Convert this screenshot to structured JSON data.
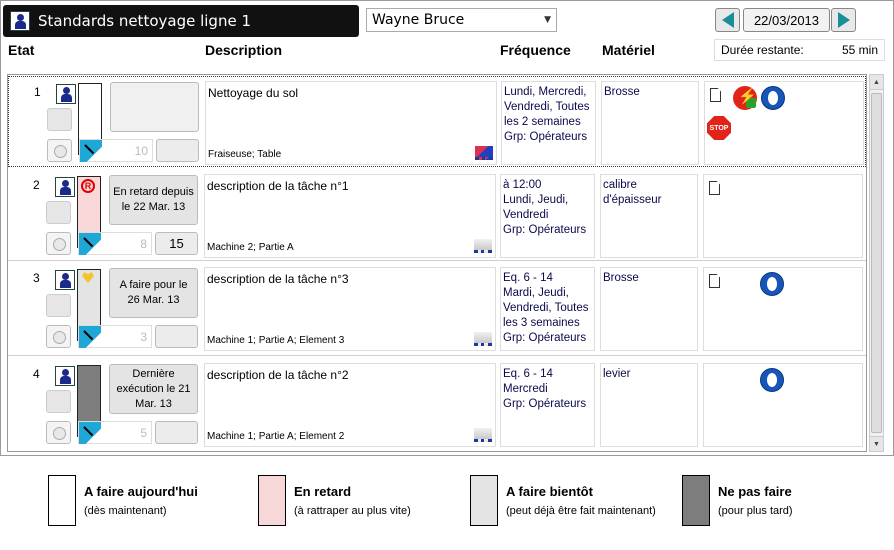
{
  "window": {
    "title": "Standards nettoyage ligne 1",
    "user": "Wayne Bruce",
    "date": "22/03/2013"
  },
  "columns": {
    "etat": "Etat",
    "description": "Description",
    "frequence": "Fréquence",
    "materiel": "Matériel"
  },
  "remaining": {
    "label": "Durée restante:",
    "value": "55 min"
  },
  "colors": {
    "today": "#ffffff",
    "late": "#f8d7d8",
    "soon": "#e4e4e4",
    "dont": "#7d7d7d",
    "accent": "#1a8f9a"
  },
  "rows": [
    {
      "num": "1",
      "status_color": "#ffffff",
      "status_label": "",
      "status_icon": "",
      "gauge_value": "10",
      "count": "",
      "description": "Nettoyage du sol",
      "location": "Fraiseuse; Table",
      "frequency": [
        "Lundi, Mercredi,",
        "Vendredi, Toutes",
        "les 2 semaines",
        "Grp: Opérateurs"
      ],
      "material": [
        "Brosse"
      ],
      "icons": [
        "document-icon",
        "electric-danger-icon",
        "safety-helmet-icon",
        "stop-sign-icon"
      ],
      "stop_label": "STOP"
    },
    {
      "num": "2",
      "status_color": "#f8d7d8",
      "status_label": "En retard depuis le 22 Mar. 13",
      "status_icon": "registered-icon",
      "gauge_value": "8",
      "count": "15",
      "description": "description de la tâche  n°1",
      "location": "Machine 2; Partie A",
      "frequency": [
        "à 12:00",
        "Lundi, Jeudi,",
        "Vendredi",
        "Grp: Opérateurs"
      ],
      "material": [
        "calibre",
        "d'épaisseur"
      ],
      "icons": [
        "document-icon"
      ]
    },
    {
      "num": "3",
      "status_color": "#e4e4e4",
      "status_label": "A faire pour le 26 Mar. 13",
      "status_icon": "heart-icon",
      "gauge_value": "3",
      "count": "",
      "description": "description de la tâche n°3",
      "location": "Machine 1; Partie A; Element 3",
      "frequency": [
        "Eq. 6 - 14",
        "Mardi, Jeudi,",
        "Vendredi, Toutes",
        "les 3 semaines",
        "Grp: Opérateurs"
      ],
      "material": [
        "Brosse"
      ],
      "icons": [
        "document-icon",
        "safety-helmet-icon"
      ]
    },
    {
      "num": "4",
      "status_color": "#7d7d7d",
      "status_label": "Dernière exécution le 21 Mar. 13",
      "status_icon": "",
      "gauge_value": "5",
      "count": "",
      "description": "description de la tâche n°2",
      "location": "Machine 1; Partie A; Element 2",
      "frequency": [
        "Eq. 6 - 14",
        "Mercredi",
        "Grp: Opérateurs"
      ],
      "material": [
        "levier"
      ],
      "icons": [
        "safety-helmet-icon"
      ]
    }
  ],
  "legend": [
    {
      "title": "A faire aujourd'hui",
      "sub": "(dès maintenant)",
      "color": "#ffffff"
    },
    {
      "title": "En retard",
      "sub": "(à rattraper au plus vite)",
      "color": "#f8d7d8"
    },
    {
      "title": "A faire bientôt",
      "sub": "(peut déjà être fait maintenant)",
      "color": "#e4e4e4"
    },
    {
      "title": "Ne pas faire",
      "sub": "(pour plus tard)",
      "color": "#7d7d7d"
    }
  ]
}
